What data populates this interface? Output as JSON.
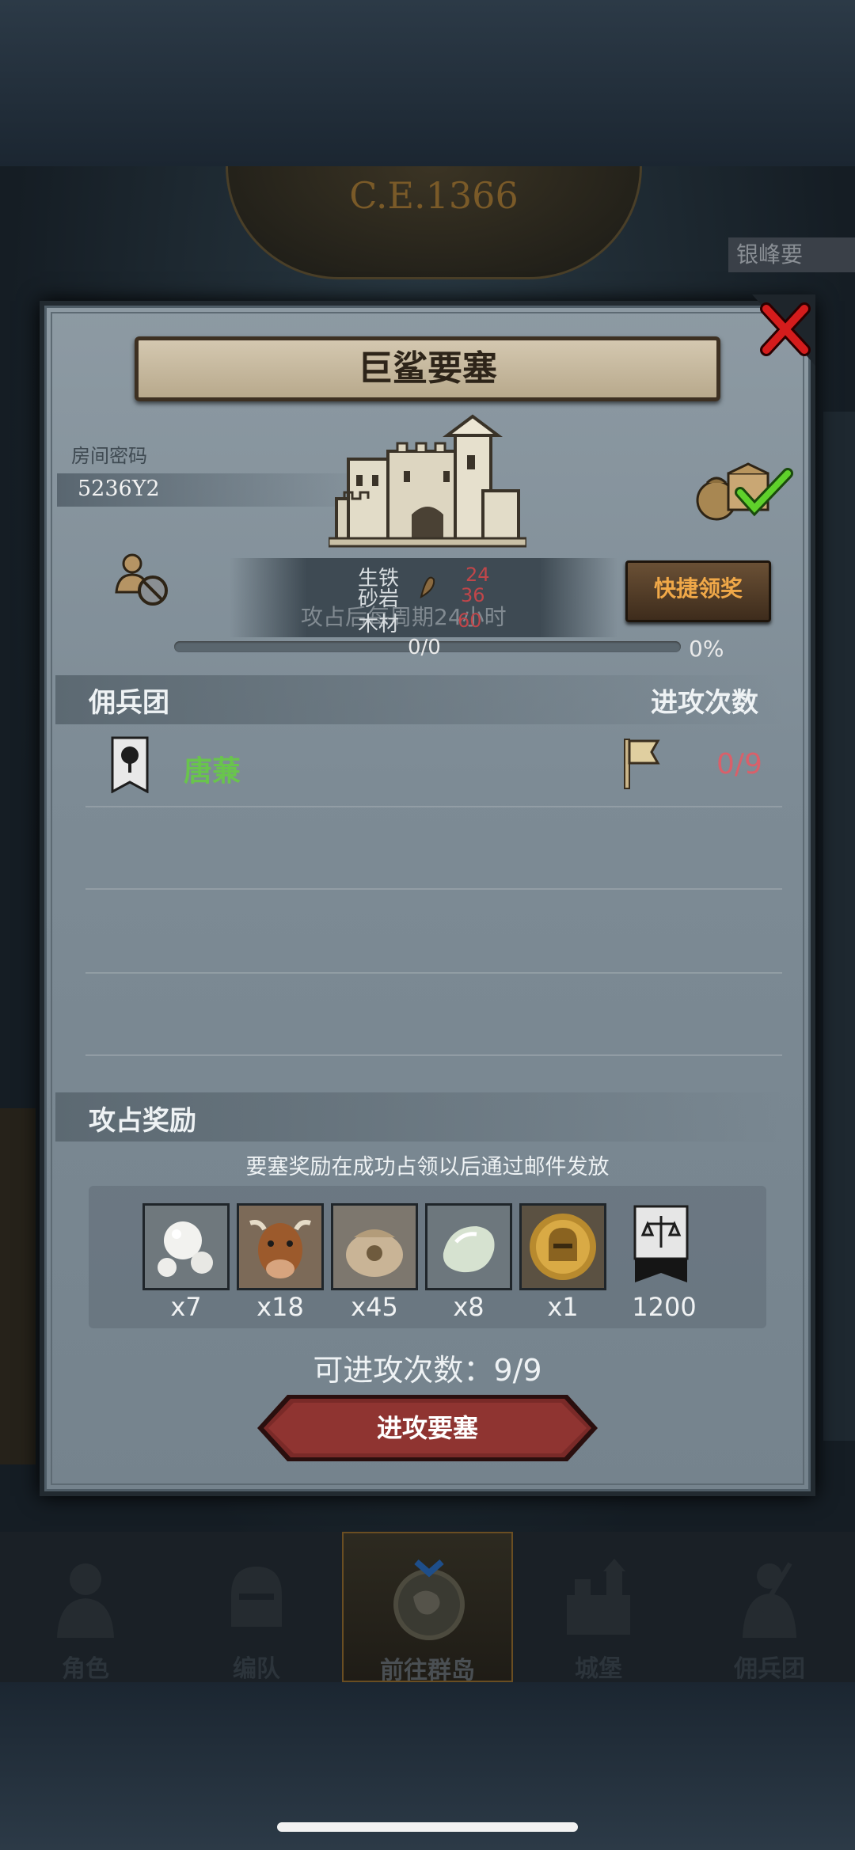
{
  "scene": {
    "year": "C.E.1366",
    "corner_label": "银峰要"
  },
  "dialog": {
    "title": "巨鲨要塞",
    "room_label": "房间密码",
    "room_code": "5236Y2",
    "resources": [
      {
        "name": "生铁",
        "value": "24"
      },
      {
        "name": "砂岩",
        "value": "36"
      },
      {
        "name": "木材",
        "value": "60"
      }
    ],
    "occupy_hint": "攻占后每周期24小时",
    "quick_claim_label": "快捷领奖",
    "progress": {
      "count": "0/0",
      "percent_label": "0%",
      "fraction": 0.0
    },
    "guild_section": {
      "title": "佣兵团",
      "right_title": "进攻次数"
    },
    "guilds": [
      {
        "name": "唐蒹",
        "attacks": "0/9"
      }
    ],
    "rewards_section": {
      "title": "攻占奖励"
    },
    "reward_note": "要塞奖励在成功占领以后通过邮件发放",
    "rewards": [
      {
        "icon": "pearl-icon",
        "qty": "x7"
      },
      {
        "icon": "cattle-icon",
        "qty": "x18"
      },
      {
        "icon": "sack-icon",
        "qty": "x45"
      },
      {
        "icon": "gem-icon",
        "qty": "x8"
      },
      {
        "icon": "helmet-coin-icon",
        "qty": "x1"
      },
      {
        "icon": "justice-banner-icon",
        "qty": "1200"
      }
    ],
    "remaining_attacks": "可进攻次数：9/9",
    "attack_button": "进攻要塞"
  },
  "navbar": {
    "items": [
      {
        "label": "角色",
        "icon": "knight-icon"
      },
      {
        "label": "编队",
        "icon": "helmet-icon"
      },
      {
        "label": "前往群岛",
        "icon": "islands-map-icon",
        "active": true
      },
      {
        "label": "城堡",
        "icon": "castle-icon"
      },
      {
        "label": "佣兵团",
        "icon": "mercenary-icon"
      }
    ]
  },
  "colors": {
    "guild_name": "#69c44d",
    "attack_count": "#d9606a",
    "quick_claim_text": "#f0a848",
    "attack_button": "#7a2a28"
  }
}
